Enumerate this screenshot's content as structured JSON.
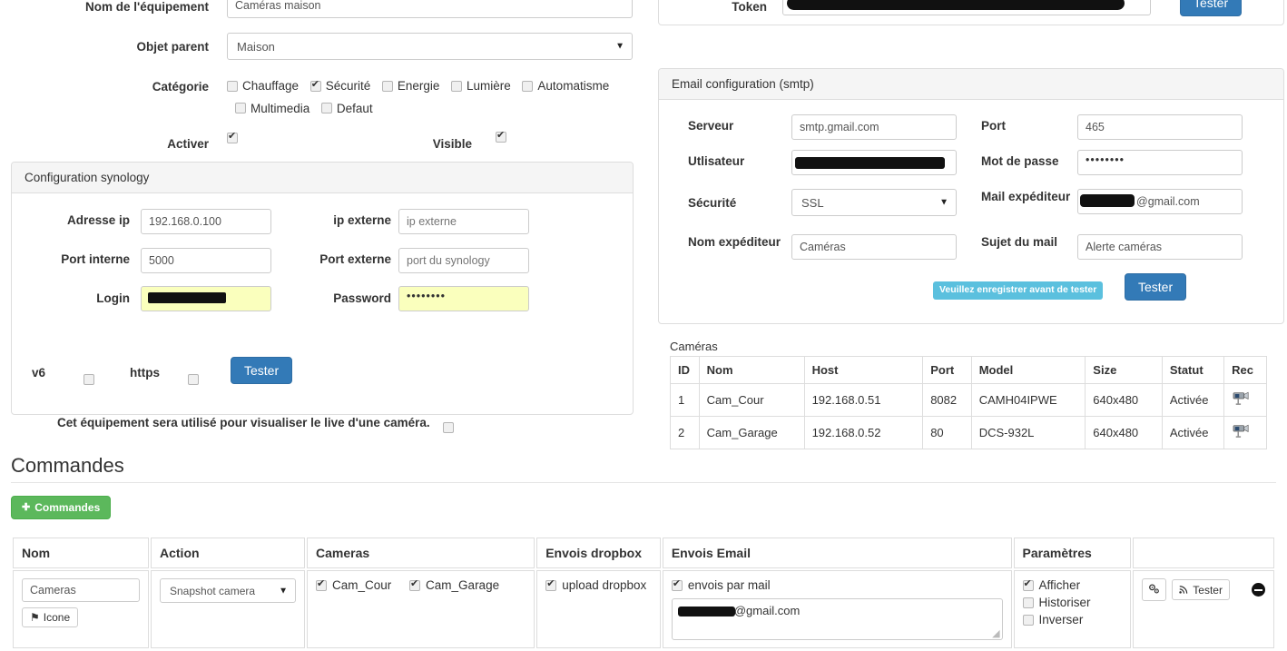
{
  "form": {
    "name_label": "Nom de l'équipement",
    "name_value": "Caméras maison",
    "parent_label": "Objet parent",
    "parent_value": "Maison",
    "category_label": "Catégorie",
    "categories": [
      {
        "label": "Chauffage",
        "checked": false
      },
      {
        "label": "Sécurité",
        "checked": true
      },
      {
        "label": "Energie",
        "checked": false
      },
      {
        "label": "Lumière",
        "checked": false
      },
      {
        "label": "Automatisme",
        "checked": false
      },
      {
        "label": "Multimedia",
        "checked": false
      },
      {
        "label": "Defaut",
        "checked": false
      }
    ],
    "activer_label": "Activer",
    "activer_checked": true,
    "visible_label": "Visible",
    "visible_checked": true
  },
  "synology": {
    "title": "Configuration synology",
    "ip_label": "Adresse ip",
    "ip_value": "192.168.0.100",
    "ip_ext_label": "ip externe",
    "ip_ext_placeholder": "ip externe",
    "port_int_label": "Port interne",
    "port_int_value": "5000",
    "port_ext_label": "Port externe",
    "port_ext_placeholder": "port du synology",
    "login_label": "Login",
    "login_value": "",
    "password_label": "Password",
    "password_value": "••••••••",
    "v6_label": "v6",
    "v6_checked": false,
    "https_label": "https",
    "https_checked": false,
    "test_button": "Tester",
    "live_note": "Cet équipement sera utilisé pour visualiser le live d'une caméra.",
    "live_checked": false
  },
  "token": {
    "label": "Token",
    "value": "",
    "test_button": "Tester"
  },
  "email": {
    "title": "Email configuration (smtp)",
    "server_label": "Serveur",
    "server_value": "smtp.gmail.com",
    "port_label": "Port",
    "port_value": "465",
    "user_label": "Utlisateur",
    "user_value": "",
    "password_label": "Mot de passe",
    "password_value": "••••••••",
    "security_label": "Sécurité",
    "security_value": "SSL",
    "sender_mail_label": "Mail expéditeur",
    "sender_mail_suffix": "@gmail.com",
    "sender_name_label": "Nom expéditeur",
    "sender_name_value": "Caméras",
    "subject_label": "Sujet du mail",
    "subject_value": "Alerte caméras",
    "tooltip": "Veuillez enregistrer avant de tester",
    "test_button": "Tester"
  },
  "cameras": {
    "caption": "Caméras",
    "columns": [
      "ID",
      "Nom",
      "Host",
      "Port",
      "Model",
      "Size",
      "Statut",
      "Rec"
    ],
    "rows": [
      {
        "id": "1",
        "nom": "Cam_Cour",
        "host": "192.168.0.51",
        "port": "8082",
        "model": "CAMH04IPWE",
        "size": "640x480",
        "statut": "Activée",
        "rec": "cctv-camera-icon"
      },
      {
        "id": "2",
        "nom": "Cam_Garage",
        "host": "192.168.0.52",
        "port": "80",
        "model": "DCS-932L",
        "size": "640x480",
        "statut": "Activée",
        "rec": "cctv-camera-icon"
      }
    ]
  },
  "commandes": {
    "title": "Commandes",
    "add_button": "Commandes",
    "columns": [
      "Nom",
      "Action",
      "Cameras",
      "Envois dropbox",
      "Envois Email",
      "Paramètres",
      ""
    ],
    "row": {
      "nom_value": "Cameras",
      "icon_button": "Icone",
      "action_value": "Snapshot camera",
      "cameras": [
        {
          "label": "Cam_Cour",
          "checked": true
        },
        {
          "label": "Cam_Garage",
          "checked": true
        }
      ],
      "dropbox": {
        "label": "upload dropbox",
        "checked": true
      },
      "email": {
        "label": "envois par mail",
        "checked": true,
        "address_suffix": "@gmail.com"
      },
      "parametres": [
        {
          "label": "Afficher",
          "checked": true
        },
        {
          "label": "Historiser",
          "checked": false
        },
        {
          "label": "Inverser",
          "checked": false
        }
      ],
      "actions": {
        "config_icon": "gears-icon",
        "test_button": "Tester",
        "test_icon": "signal-icon",
        "remove_icon": "minus-circle-icon"
      }
    }
  },
  "colors": {
    "primary_blue": "#337ab7",
    "success_green": "#5cb85c",
    "info_cyan": "#5bc0de",
    "autofill_yellow": "#faffbd",
    "border_gray": "#dddddd"
  }
}
